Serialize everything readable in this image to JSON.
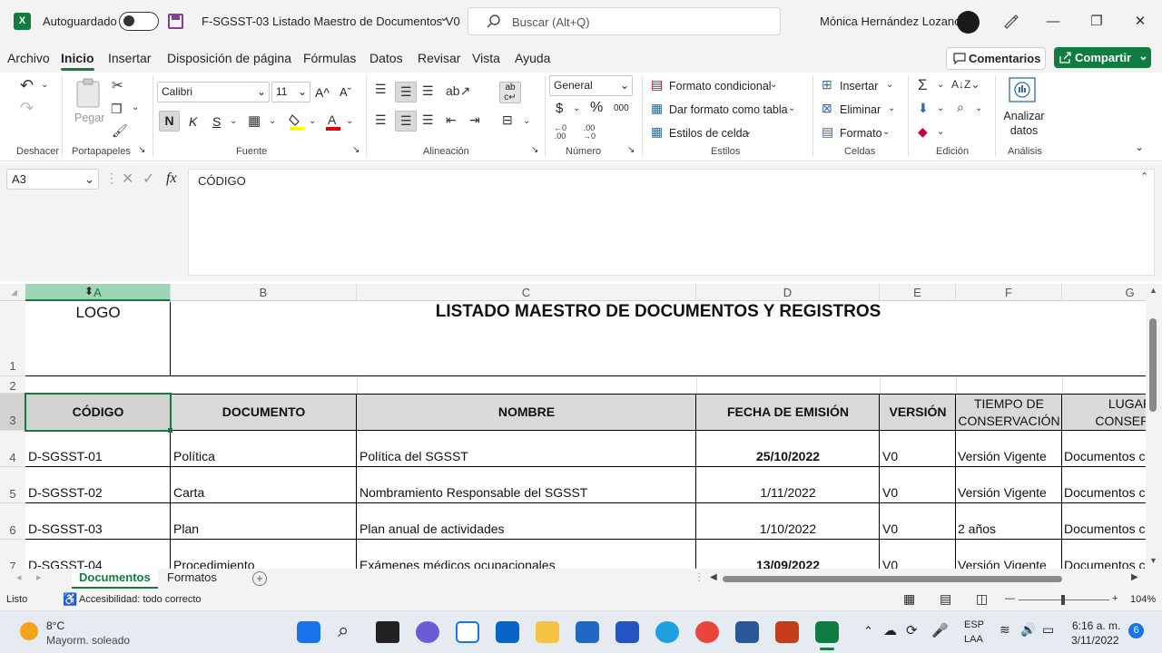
{
  "titlebar": {
    "app_icon": "excel-icon",
    "autosave_label": "Autoguardado",
    "autosave_state": "off",
    "doc_title": "F-SGSST-03 Listado Maestro de Documentos V0",
    "doc_title_chevron": "⌄",
    "search_placeholder": "Buscar (Alt+Q)",
    "user_name": "Mónica Hernández Lozano",
    "window_controls": [
      "—",
      "❐",
      "✕"
    ]
  },
  "menu": {
    "items": [
      "Archivo",
      "Inicio",
      "Insertar",
      "Disposición de página",
      "Fórmulas",
      "Datos",
      "Revisar",
      "Vista",
      "Ayuda"
    ],
    "active": "Inicio",
    "comments_label": "Comentarios",
    "share_label": "Compartir",
    "share_chevron": "⌄"
  },
  "ribbon": {
    "groups": {
      "undo": "Deshacer",
      "clipboard": "Portapapeles",
      "font": "Fuente",
      "alignment": "Alineación",
      "number": "Número",
      "styles": "Estilos",
      "cells": "Celdas",
      "editing": "Edición",
      "analysis": "Análisis"
    },
    "paste_label": "Pegar",
    "font_name": "Calibri",
    "font_size": "11",
    "grow_font": "A^",
    "shrink_font": "Aˇ",
    "bold": "N",
    "italic": "K",
    "underline": "S",
    "number_format": "General",
    "currency": "$",
    "percent": "%",
    "thousands": "000",
    "conditional_format": "Formato condicional",
    "format_as_table": "Dar formato como tabla",
    "cell_styles": "Estilos de celda",
    "insert": "Insertar",
    "delete": "Eliminar",
    "format": "Formato",
    "analyze_label": "Analizar datos"
  },
  "formula_bar": {
    "name_box": "A3",
    "fx": "fx",
    "content": "CÓDIGO"
  },
  "sheet": {
    "columns": [
      "A",
      "B",
      "C",
      "D",
      "E",
      "F",
      "G"
    ],
    "row_numbers": [
      "1",
      "2",
      "3",
      "4",
      "5",
      "6",
      "7"
    ],
    "logo_text": "LOGO",
    "title": "LISTADO MAESTRO DE DOCUMENTOS Y REGISTROS",
    "headers": [
      "CÓDIGO",
      "DOCUMENTO",
      "NOMBRE",
      "FECHA DE EMISIÓN",
      "VERSIÓN",
      "TIEMPO DE CONSERVACIÓN",
      "LUGAR DE CONSERVACIÓN"
    ],
    "header_f_line1": "TIEMPO DE",
    "header_f_line2": "CONSERVACIÓN",
    "header_g_line1": "LUGAR",
    "header_g_line2": "CONSERVA",
    "rows": [
      {
        "codigo": "D-SGSST-01",
        "documento": "Política",
        "nombre": "Política del SGSST",
        "fecha": "25/10/2022",
        "version": "V0",
        "tiempo": "Versión Vigente",
        "lugar": "Documentos c"
      },
      {
        "codigo": "D-SGSST-02",
        "documento": "Carta",
        "nombre": "Nombramiento Responsable del SGSST",
        "fecha": "1/11/2022",
        "version": "V0",
        "tiempo": "Versión Vigente",
        "lugar": "Documentos c"
      },
      {
        "codigo": "D-SGSST-03",
        "documento": "Plan",
        "nombre": "Plan anual de actividades",
        "fecha": "1/10/2022",
        "version": "V0",
        "tiempo": "2 años",
        "lugar": "Documentos c"
      },
      {
        "codigo": "D-SGSST-04",
        "documento": "Procedimiento",
        "nombre": "Exámenes médicos ocupacionales",
        "fecha": "13/09/2022",
        "version": "V0",
        "tiempo": "Versión Vigente",
        "lugar": "Documentos c"
      }
    ]
  },
  "tabs": {
    "items": [
      "Documentos",
      "Formatos"
    ],
    "active": "Documentos",
    "add": "+"
  },
  "status": {
    "ready": "Listo",
    "accessibility": "Accesibilidad: todo correcto",
    "zoom": "104%",
    "zoom_minus": "—",
    "zoom_plus": "+"
  },
  "taskbar": {
    "weather_temp": "8°C",
    "weather_desc": "Mayorm. soleado",
    "lang_line1": "ESP",
    "lang_line2": "LAA",
    "time": "6:16 a. m.",
    "date": "3/11/2022",
    "notifications": "6"
  },
  "colors": {
    "excel_green": "#107c41",
    "header_fill": "#d9d9d9",
    "ribbon_bg": "#f3f3f3"
  }
}
